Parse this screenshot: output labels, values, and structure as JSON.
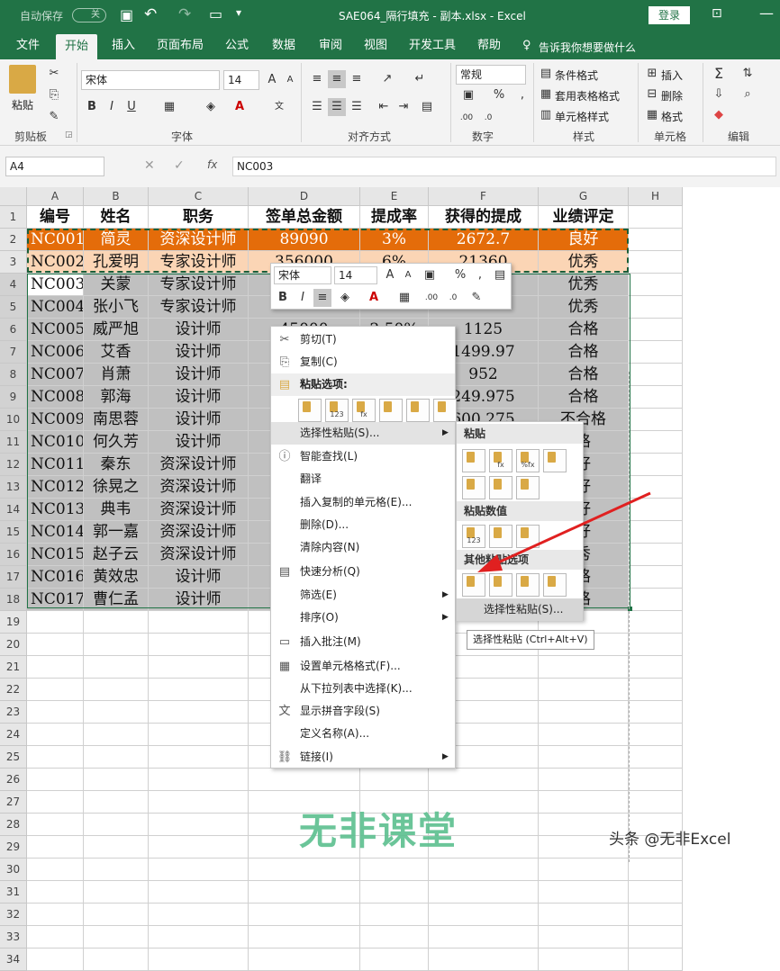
{
  "titlebar": {
    "autosave": "自动保存",
    "autosave_state": "关",
    "title": "SAE064_隔行填充 - 副本.xlsx  -  Excel",
    "login": "登录"
  },
  "tabs": [
    "文件",
    "开始",
    "插入",
    "页面布局",
    "公式",
    "数据",
    "审阅",
    "视图",
    "开发工具",
    "帮助"
  ],
  "tell_me": "告诉我你想要做什么",
  "ribbon": {
    "paste": "粘贴",
    "clipboard": "剪贴板",
    "font_name": "宋体",
    "font_size": "14",
    "font_group": "字体",
    "align_group": "对齐方式",
    "number_format": "常规",
    "number_group": "数字",
    "cond_format": "条件格式",
    "table_format": "套用表格格式",
    "cell_style": "单元格样式",
    "style_group": "样式",
    "insert": "插入",
    "delete": "删除",
    "format": "格式",
    "cells_group": "单元格",
    "edit_group": "编辑"
  },
  "formula": {
    "name_box": "A4",
    "content": "NC003",
    "fx": "fx"
  },
  "columns": [
    "A",
    "B",
    "C",
    "D",
    "E",
    "F",
    "G",
    "H"
  ],
  "rows": [
    [
      "编号",
      "姓名",
      "职务",
      "签单总金额",
      "提成率",
      "获得的提成",
      "业绩评定"
    ],
    [
      "NC001",
      "简灵",
      "资深设计师",
      "89090",
      "3%",
      "2672.7",
      "良好"
    ],
    [
      "NC002",
      "孔爱明",
      "专家设计师",
      "356000",
      "6%",
      "21360",
      "优秀"
    ],
    [
      "NC003",
      "关蒙",
      "专家设计师",
      "",
      "",
      "",
      "优秀"
    ],
    [
      "NC004",
      "张小飞",
      "专家设计师",
      "",
      "",
      "",
      "优秀"
    ],
    [
      "NC005",
      "威严旭",
      "设计师",
      "45000",
      "2.50%",
      "1125",
      "合格"
    ],
    [
      "NC006",
      "艾香",
      "设计师",
      "",
      "",
      "1499.97",
      "合格"
    ],
    [
      "NC007",
      "肖萧",
      "设计师",
      "",
      "",
      "952",
      "合格"
    ],
    [
      "NC008",
      "郭海",
      "设计师",
      "",
      "",
      "249.975",
      "合格"
    ],
    [
      "NC009",
      "南思蓉",
      "设计师",
      "",
      "",
      "600.275",
      "不合格"
    ],
    [
      "NC010",
      "何久芳",
      "设计师",
      "",
      "",
      "",
      "格"
    ],
    [
      "NC011",
      "秦东",
      "资深设计师",
      "",
      "",
      "",
      "好"
    ],
    [
      "NC012",
      "徐晃之",
      "资深设计师",
      "",
      "",
      "",
      "好"
    ],
    [
      "NC013",
      "典韦",
      "资深设计师",
      "",
      "",
      "",
      "好"
    ],
    [
      "NC014",
      "郭一嘉",
      "资深设计师",
      "",
      "",
      "",
      "好"
    ],
    [
      "NC015",
      "赵子云",
      "资深设计师",
      "",
      "",
      "",
      "秀"
    ],
    [
      "NC016",
      "黄效忠",
      "设计师",
      "",
      "",
      "",
      "格"
    ],
    [
      "NC017",
      "曹仁孟",
      "设计师",
      "",
      "",
      "",
      "格"
    ]
  ],
  "row_numbers": [
    "1",
    "2",
    "3",
    "4",
    "5",
    "6",
    "7",
    "8",
    "9",
    "10",
    "11",
    "12",
    "13",
    "14",
    "15",
    "16",
    "17",
    "18",
    "19",
    "20",
    "21",
    "22",
    "23",
    "24",
    "25",
    "26",
    "27",
    "28",
    "29",
    "30",
    "31",
    "32",
    "33",
    "34"
  ],
  "mini_toolbar": {
    "font": "宋体",
    "size": "14"
  },
  "context_menu": {
    "items": [
      {
        "icon": "✂",
        "label": "剪切(T)"
      },
      {
        "icon": "⎘",
        "label": "复制(C)"
      },
      {
        "icon": "",
        "label": "粘贴选项:"
      },
      {
        "icon": "",
        "label": ""
      },
      {
        "icon": "",
        "label": "选择性粘贴(S)..."
      },
      {
        "icon": "ⓘ",
        "label": "智能查找(L)"
      },
      {
        "icon": "",
        "label": "翻译"
      },
      {
        "icon": "",
        "label": "插入复制的单元格(E)..."
      },
      {
        "icon": "",
        "label": "删除(D)..."
      },
      {
        "icon": "",
        "label": "清除内容(N)"
      },
      {
        "icon": "▤",
        "label": "快速分析(Q)"
      },
      {
        "icon": "",
        "label": "筛选(E)"
      },
      {
        "icon": "",
        "label": "排序(O)"
      },
      {
        "icon": "▭",
        "label": "插入批注(M)"
      },
      {
        "icon": "▦",
        "label": "设置单元格格式(F)..."
      },
      {
        "icon": "",
        "label": "从下拉列表中选择(K)..."
      },
      {
        "icon": "文",
        "label": "显示拼音字段(S)"
      },
      {
        "icon": "",
        "label": "定义名称(A)..."
      },
      {
        "icon": "⛓",
        "label": "链接(I)"
      }
    ],
    "paste_icon_labels": [
      "123",
      "fx"
    ]
  },
  "submenu": {
    "paste": "粘贴",
    "paste_values": "粘贴数值",
    "other_paste": "其他粘贴选项",
    "paste_special": "选择性粘贴(S)...",
    "icon_labels": [
      "fx",
      "%fx",
      "123"
    ]
  },
  "tooltip": "选择性粘贴 (Ctrl+Alt+V)",
  "watermark": "无非课堂",
  "credit": "头条 @无非Excel",
  "colors": {
    "excel_green": "#217346",
    "orange": "#e46c0a",
    "peach": "#fbd5b5",
    "selection_gray": "#c0c0c0",
    "arrow": "#e02020"
  }
}
